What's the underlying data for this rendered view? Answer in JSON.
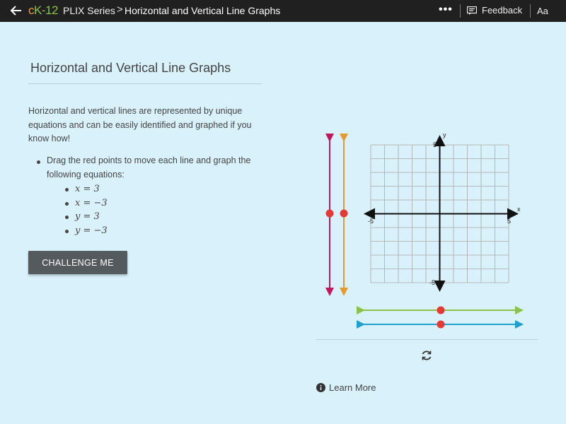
{
  "header": {
    "brand_c": "c",
    "brand_k12": "K-12",
    "series_label": "PLIX Series",
    "breadcrumb_separator": ">",
    "title": "Horizontal and Vertical Line Graphs",
    "more_label": "•••",
    "feedback_label": "Feedback",
    "text_size_label": "Aa",
    "icons": [
      "back-arrow-icon",
      "more-icon",
      "feedback-icon"
    ]
  },
  "content": {
    "title": "Horizontal and Vertical Line Graphs",
    "intro": "Horizontal and vertical lines are represented by unique equations and can be easily identified and graphed if you know how!",
    "instructions": "Drag the red points to move each line and graph the following equations:",
    "equations": [
      "x = 3",
      "x = −3",
      "y = 3",
      "y = −3"
    ],
    "challenge_label": "CHALLENGE ME"
  },
  "graph": {
    "x_axis_label": "x",
    "y_axis_label": "y",
    "x_min_label": "-5",
    "x_max_label": "5",
    "y_max_label": "5",
    "y_min_label": "-5",
    "x_range": [
      -5,
      5
    ],
    "y_range": [
      -5,
      5
    ],
    "colors": {
      "vertical_line_1": "#c2185b",
      "vertical_line_2": "#e69a2e",
      "horizontal_line_1": "#8bc34a",
      "horizontal_line_2": "#1e9fd0",
      "handle": "#e53935",
      "grid": "#aaaaaa",
      "axis": "#111111"
    }
  },
  "footer": {
    "learn_more_label": "Learn More",
    "icons": [
      "refresh-icon",
      "info-icon"
    ]
  }
}
